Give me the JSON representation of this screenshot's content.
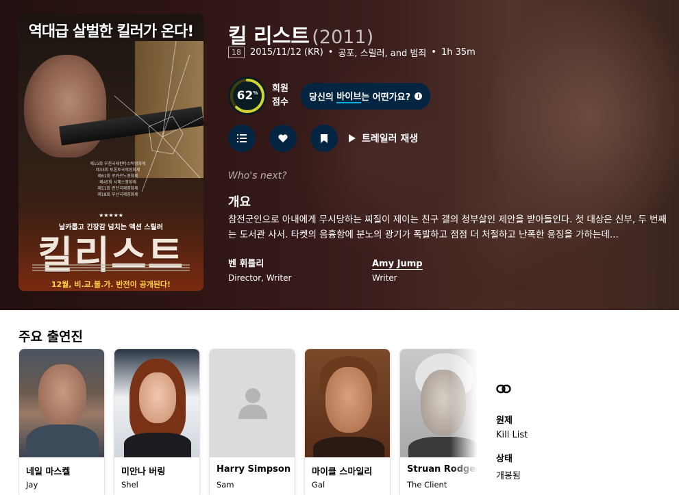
{
  "poster": {
    "headline": "역대급 살벌한 킬러가 온다!",
    "awards": "제15회 부천국제판타스틱영화제\n제33회 토론토국제영화제\n제61회 로카르노영화제\n제45회 시체스영화제\n제51회 런던국제영화제\n제18회 부산국제영화제",
    "stars": "★★★★★",
    "tagline": "날카롭고 긴장감 넘치는 액션 스릴러",
    "title": "킬리스트",
    "release": "12월, 비.교.불.가. 반전이 공개된다!"
  },
  "movie": {
    "title": "킬 리스트",
    "year": "(2011)",
    "certification": "18",
    "release_date": "2015/11/12 (KR)",
    "genres": "공포, 스릴러, and 범죄",
    "runtime": "1h 35m"
  },
  "score": {
    "value": "62",
    "percent_sign": "%",
    "fraction": 0.62,
    "label": "회원 점수",
    "ring_color": "#d2d531"
  },
  "vibe": {
    "prefix": "당신의 ",
    "highlight": "바이브",
    "suffix": "는 어떤가요?"
  },
  "actions": {
    "trailer_label": "트레일러 재생"
  },
  "whos_next": "Who's next?",
  "overview": {
    "heading": "개요",
    "text": "참전군인으로 아내에게 무시당하는 찌질이 제이는 친구 갤의 청부살인 제안을 받아들인다. 첫 대상은 신부, 두 번째는 도서관 사서. 타켓의 음흉함에 분노의 광기가 폭발하고 점점 더 처절하고 난폭한 응징을 가하는데..."
  },
  "crew": [
    {
      "name": "벤 휘틀리",
      "role": "Director, Writer"
    },
    {
      "name": "Amy Jump",
      "role": "Writer"
    }
  ],
  "cast": {
    "heading": "주요 출연진",
    "members": [
      {
        "name": "네일 마스켈",
        "character": "Jay"
      },
      {
        "name": "미안나 버링",
        "character": "Shel"
      },
      {
        "name": "Harry Simpson",
        "character": "Sam"
      },
      {
        "name": "마이클 스마일리",
        "character": "Gal"
      },
      {
        "name": "Struan Rodger",
        "character": "The Client"
      }
    ]
  },
  "facts": {
    "original_title_label": "원제",
    "original_title": "Kill List",
    "status_label": "상태",
    "status": "개봉됨"
  },
  "colors": {
    "accent_navy": "#032541",
    "score_ring": "#d2d531",
    "highlight_underline": "#0bb4e3"
  }
}
